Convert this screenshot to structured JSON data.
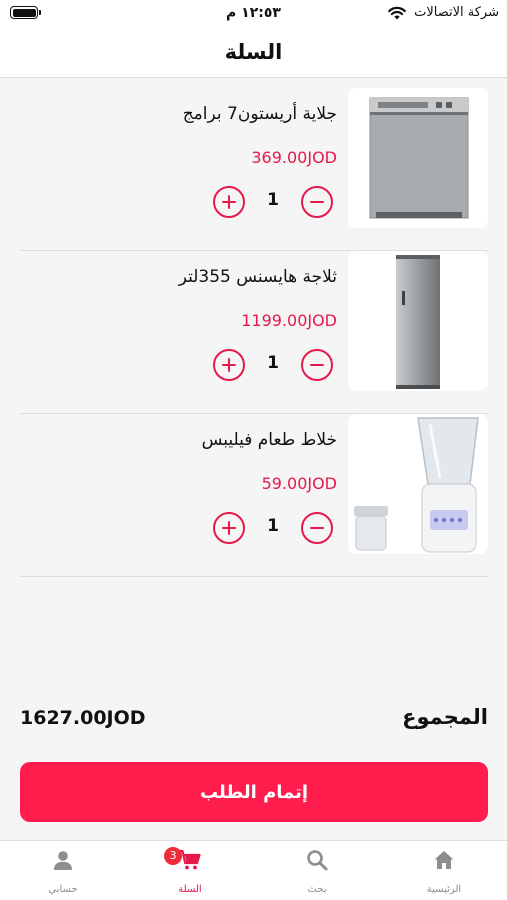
{
  "status_bar": {
    "time": "١٢:٥٣ م",
    "carrier": "شركة الاتصالات"
  },
  "header": {
    "title": "السلة"
  },
  "cart_items": [
    {
      "name": "جلاية أريستون7 برامج",
      "price": "369.00JOD",
      "quantity": "1",
      "image_icon": "dishwasher-image"
    },
    {
      "name": "ثلاجة هايسنس 355لتر",
      "price": "1199.00JOD",
      "quantity": "1",
      "image_icon": "refrigerator-image"
    },
    {
      "name": "خلاط طعام فيليبس",
      "price": "59.00JOD",
      "quantity": "1",
      "image_icon": "blender-image"
    }
  ],
  "total": {
    "label": "المجموع",
    "value": "1627.00JOD"
  },
  "checkout": {
    "label": "إتمام الطلب"
  },
  "bottom_nav": {
    "items": [
      {
        "label": "الرئيسية",
        "icon": "home-icon"
      },
      {
        "label": "بحث",
        "icon": "search-icon"
      },
      {
        "label": "السلة",
        "icon": "cart-icon",
        "badge": "3",
        "active": true
      },
      {
        "label": "حسابي",
        "icon": "user-icon"
      }
    ]
  },
  "colors": {
    "accent": "#e6194b",
    "button": "#ff1d4e",
    "badge": "#ef2b3a",
    "nav_inactive": "#8e8e8e"
  }
}
